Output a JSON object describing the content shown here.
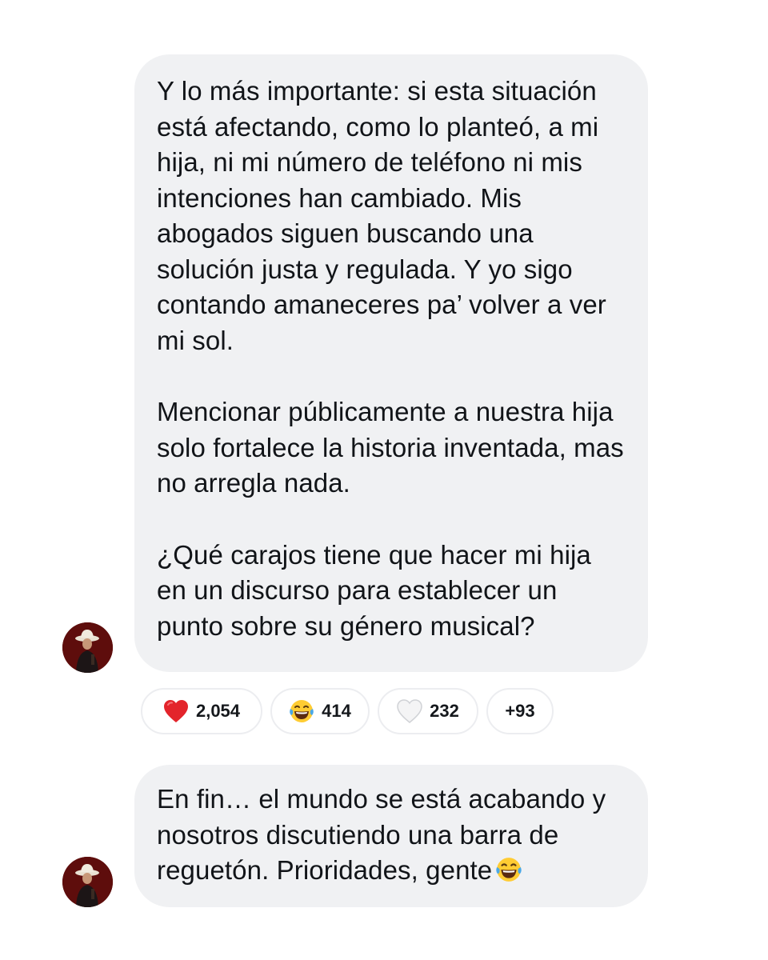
{
  "messages": [
    {
      "paragraphs": [
        "Y lo más importante: si esta situación está afectando, como lo planteó, a mi hija, ni mi número de teléfono ni mis intenciones han cambiado. Mis abogados siguen buscando una solución justa y regulada. Y yo sigo contando amaneceres pa’ volver a ver mi sol.",
        "Mencionar públicamente a nuestra hija solo fortalece la historia inventada, mas no arregla nada.",
        "¿Qué carajos tiene que hacer mi hija en un discurso para establecer un punto sobre su género musical?"
      ],
      "avatar_icon": "sender-avatar-cowboy"
    },
    {
      "text": "En fin… el mundo se está acabando y nosotros discutiendo una barra de reguetón. Prioridades, gente",
      "trailing_emoji": "face-with-tears-of-joy",
      "avatar_icon": "sender-avatar-cowboy"
    }
  ],
  "reactions": [
    {
      "emoji": "red-heart",
      "count": "2,054"
    },
    {
      "emoji": "face-with-tears-of-joy",
      "count": "414"
    },
    {
      "emoji": "white-heart",
      "count": "232"
    },
    {
      "emoji": "",
      "count": "+93"
    }
  ],
  "colors": {
    "bubble": "#f0f1f3",
    "text": "#111418",
    "heart_red": "#e3242b",
    "emoji_yellow": "#ffcc33",
    "avatar_bg": "#6a1110"
  }
}
